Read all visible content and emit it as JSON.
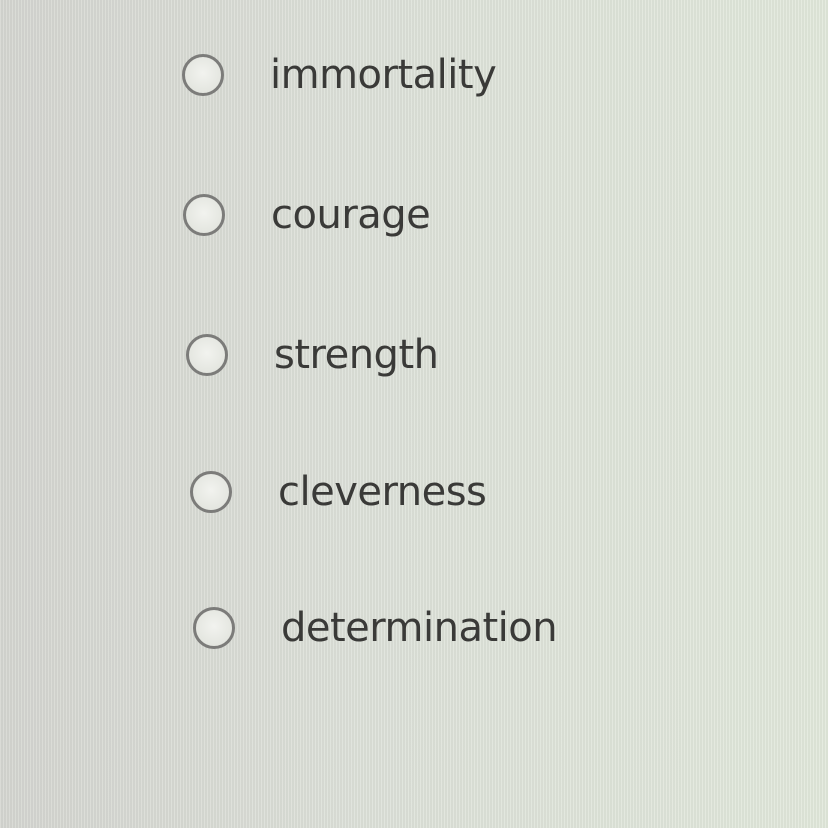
{
  "question": {
    "options": [
      {
        "label": "immortality",
        "selected": false
      },
      {
        "label": "courage",
        "selected": false
      },
      {
        "label": "strength",
        "selected": false
      },
      {
        "label": "cleverness",
        "selected": false
      },
      {
        "label": "determination",
        "selected": false
      }
    ]
  }
}
